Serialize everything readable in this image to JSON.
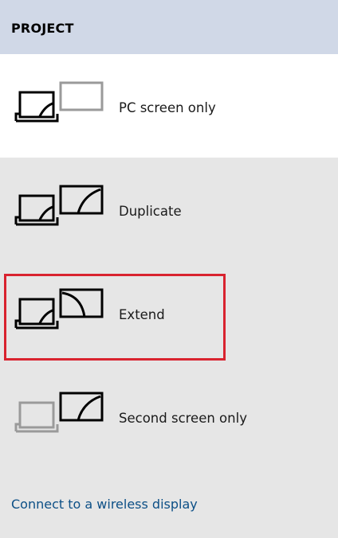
{
  "header": {
    "title": "PROJECT"
  },
  "options": [
    {
      "label": "PC screen only",
      "icon": "pc-screen-only-icon",
      "highlighted": true
    },
    {
      "label": "Duplicate",
      "icon": "duplicate-icon",
      "highlighted": false
    },
    {
      "label": "Extend",
      "icon": "extend-icon",
      "highlighted": false,
      "focused": true
    },
    {
      "label": "Second screen only",
      "icon": "second-screen-only-icon",
      "highlighted": false
    }
  ],
  "footer": {
    "wireless_link": "Connect to a wireless display"
  },
  "colors": {
    "header_bg": "#d0d8e7",
    "panel_bg": "#e6e6e6",
    "selected_bg": "#ffffff",
    "focus_border": "#d9232f",
    "link": "#0c4f86"
  }
}
